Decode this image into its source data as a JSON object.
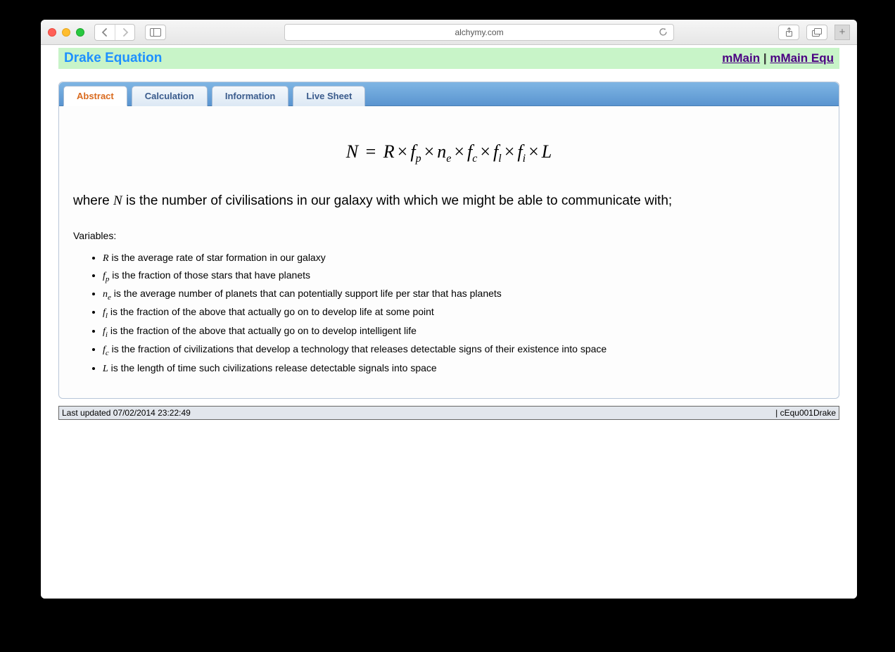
{
  "browser": {
    "url": "alchymy.com"
  },
  "header": {
    "title": "Drake Equation",
    "link1": "mMain",
    "sep": " | ",
    "link2": "mMain Equ"
  },
  "tabs": {
    "abstract": "Abstract",
    "calculation": "Calculation",
    "information": "Information",
    "livesheet": "Live Sheet"
  },
  "content": {
    "equation_html": "N = R × f_p × n_e × f_c × f_l × f_i × L",
    "where_prefix": "where ",
    "where_var": "N",
    "where_suffix": " is the number of civilisations in our galaxy with which we might be able to communicate with;",
    "variables_label": "Variables:",
    "vars": [
      {
        "sym": "R",
        "sub": "",
        "desc": " is the average rate of star formation in our galaxy"
      },
      {
        "sym": "f",
        "sub": "p",
        "desc": " is the fraction of those stars that have planets"
      },
      {
        "sym": "n",
        "sub": "e",
        "desc": " is the average number of planets that can potentially support life per star that has planets"
      },
      {
        "sym": "f",
        "sub": "l",
        "desc": " is the fraction of the above that actually go on to develop life at some point"
      },
      {
        "sym": "f",
        "sub": "i",
        "desc": " is the fraction of the above that actually go on to develop intelligent life"
      },
      {
        "sym": "f",
        "sub": "c",
        "desc": " is the fraction of civilizations that develop a technology that releases detectable signs of their existence into space"
      },
      {
        "sym": "L",
        "sub": "",
        "desc": " is the length of time such civilizations release detectable signals into space"
      }
    ]
  },
  "footer": {
    "left": "Last updated 07/02/2014 23:22:49",
    "right": "| cEqu001Drake"
  }
}
